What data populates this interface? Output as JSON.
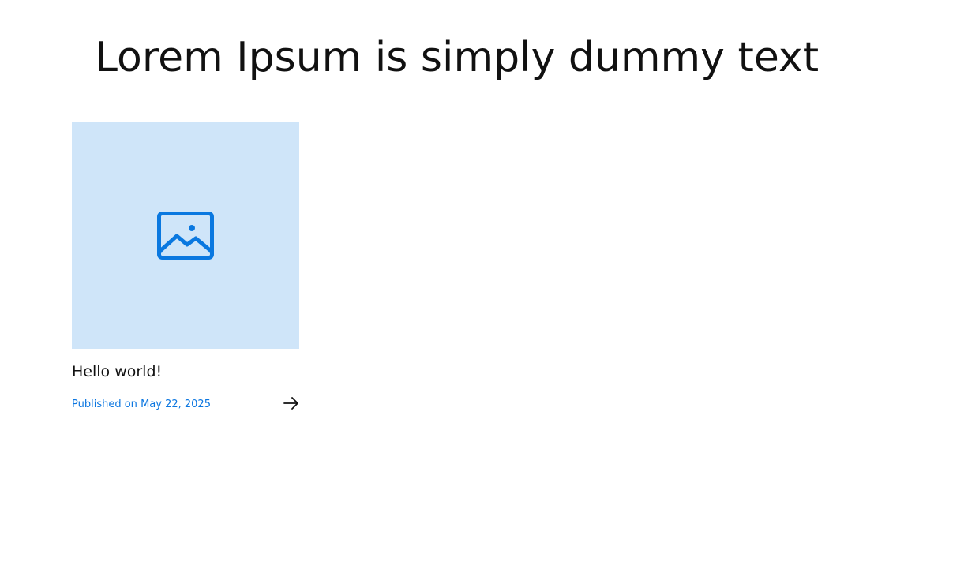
{
  "page": {
    "heading": "Lorem Ipsum is simply dummy text"
  },
  "post": {
    "title": "Hello world!",
    "published_label": "Published on",
    "published_date": "May 22, 2025",
    "image_icon": "image-placeholder-icon",
    "arrow_icon": "arrow-right-icon"
  },
  "colors": {
    "accent": "#0b76e0",
    "thumbnail_bg": "#cfe5f9",
    "icon": "#0a78e0",
    "text": "#111111"
  }
}
